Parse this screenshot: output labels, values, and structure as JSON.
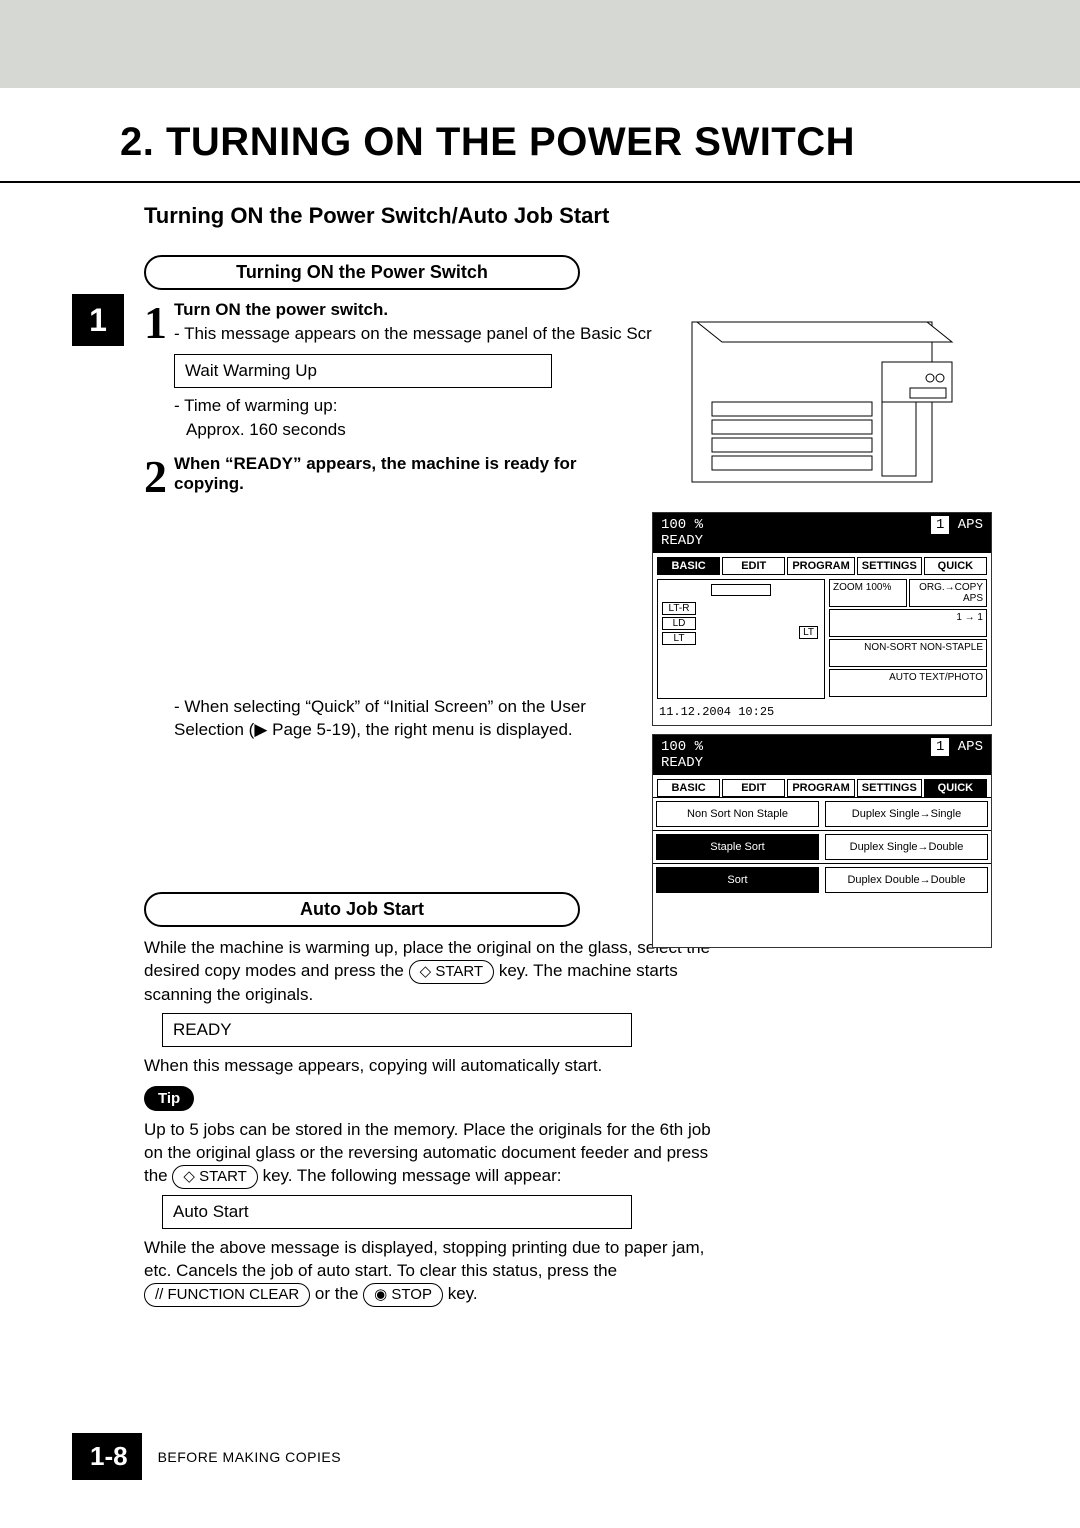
{
  "heading": {
    "number": "2.",
    "title": "TURNING ON THE POWER SWITCH",
    "subtitle": "Turning ON the Power Switch/Auto Job Start"
  },
  "chapter_tab": "1",
  "section1": {
    "pill_title": "Turning ON the Power Switch",
    "step1": {
      "num": "1",
      "title": "Turn ON the power switch.",
      "line1": "This message appears on the message panel of the Basic Screen:",
      "msg_box": "Wait Warming Up",
      "line2": "Time of warming up:",
      "line3": "Approx. 160 seconds"
    },
    "step2": {
      "num": "2",
      "title": "When “READY” appears, the machine is ready for copying."
    },
    "quick_para": "When selecting “Quick” of “Initial Screen” on the User Selection (▶ Page 5-19), the right menu is displayed."
  },
  "screen1": {
    "head_percent": "100  %",
    "head_ready": "READY",
    "head_count": "1",
    "head_aps": "APS",
    "tabs": [
      "BASIC",
      "EDIT",
      "PROGRAM",
      "SETTINGS",
      "QUICK"
    ],
    "trays": [
      "LT-R",
      "LD",
      "LT",
      "LT"
    ],
    "lt_side": "LT",
    "right_cells": [
      "ZOOM 100%",
      "ORG.→COPY  APS",
      "1 → 1",
      "NON-SORT NON-STAPLE",
      "AUTO TEXT/PHOTO"
    ],
    "datetime": "11.12.2004 10:25"
  },
  "screen2": {
    "head_percent": "100  %",
    "head_ready": "READY",
    "head_count": "1",
    "head_aps": "APS",
    "tabs": [
      "BASIC",
      "EDIT",
      "PROGRAM",
      "SETTINGS",
      "QUICK"
    ],
    "rows_left": [
      "Non Sort\nNon Staple",
      "Staple Sort",
      "Sort"
    ],
    "rows_right": [
      "Duplex\nSingle→Single",
      "Duplex\nSingle→Double",
      "Duplex\nDouble→Double"
    ]
  },
  "section2": {
    "pill_title": "Auto Job Start",
    "para1_a": "While the machine is warming up, place the original on the glass, select the desired copy modes and press the ",
    "key_start": "◇ START",
    "para1_b": " key. The machine starts scanning the originals.",
    "msg_ready": "READY",
    "para2": "When this message appears, copying will automatically start.",
    "tip": "Tip",
    "para3_a": "Up to 5 jobs can be stored in the memory. Place the originals for the 6th job on the original glass or the reversing automatic document feeder and press the ",
    "para3_b": " key. The following message will appear:",
    "msg_auto": "Auto Start",
    "para4": "While the above message is displayed, stopping printing due to paper jam, etc. Cancels the job of auto start. To clear this status, press the ",
    "key_clear": "// FUNCTION CLEAR",
    "para4_b": " or the ",
    "key_stop": "◉ STOP",
    "para4_c": " key."
  },
  "footer": {
    "pagenum": "1-8",
    "label": "BEFORE MAKING COPIES"
  }
}
